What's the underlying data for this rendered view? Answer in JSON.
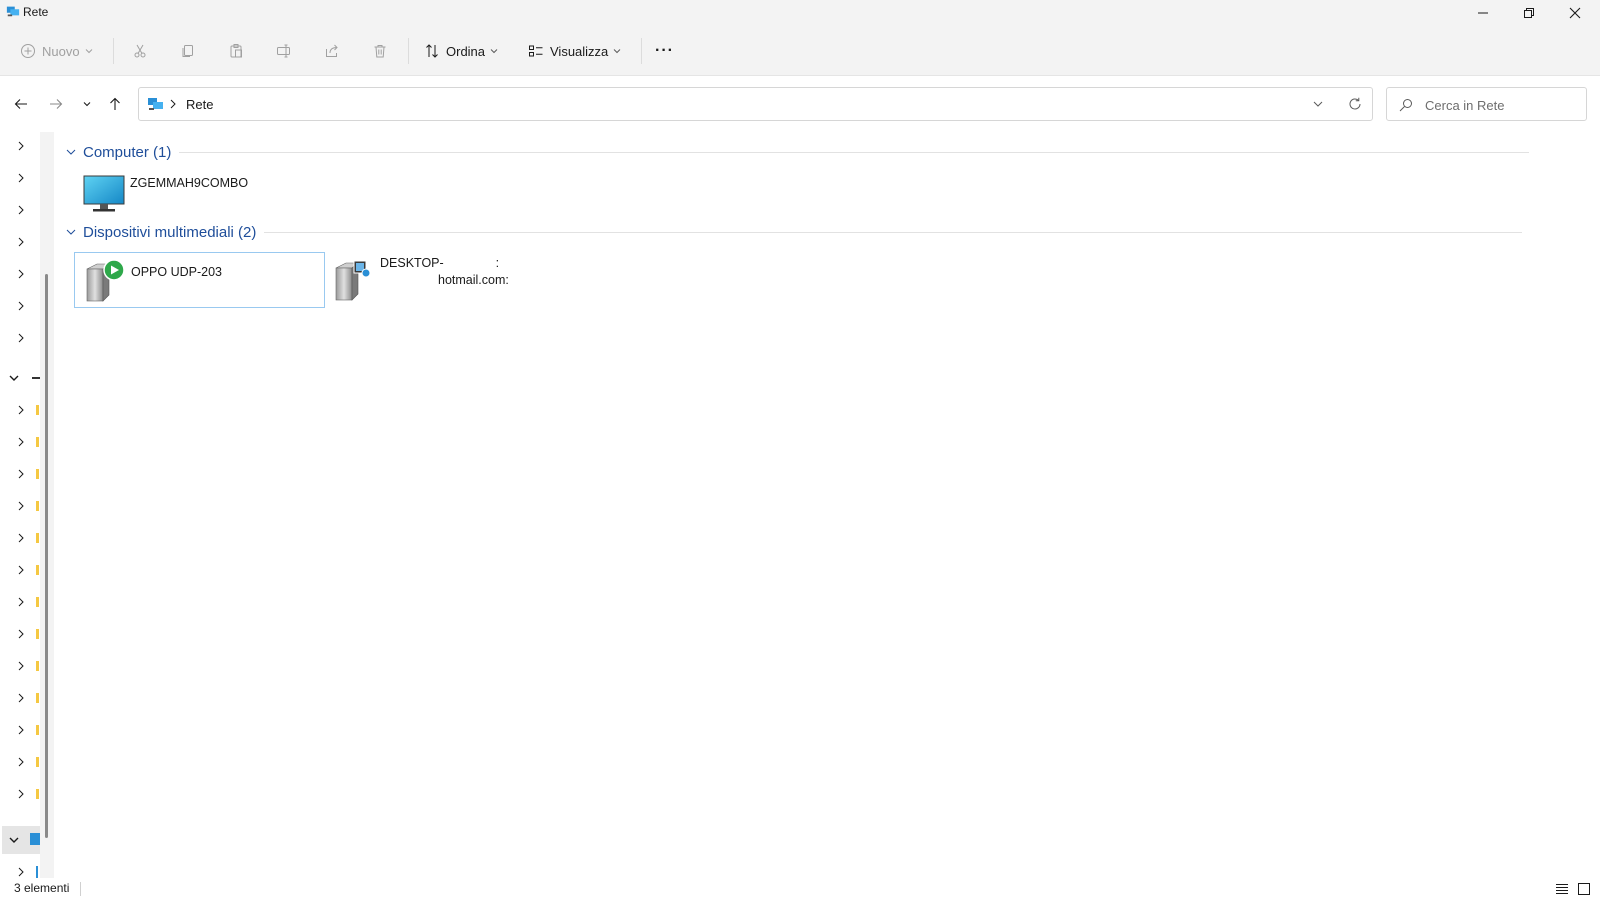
{
  "window": {
    "title": "Rete",
    "icon": "network-icon",
    "controls": [
      "minimize-icon",
      "restore-icon",
      "close-icon"
    ]
  },
  "commandbar": {
    "new_label": "Nuovo",
    "sort_label": "Ordina",
    "view_label": "Visualizza",
    "more_label": "···",
    "icons": [
      "plus-circle-icon",
      "cut-icon",
      "copy-icon",
      "paste-icon",
      "rename-icon",
      "share-icon",
      "delete-icon",
      "sort-icon",
      "view-icon",
      "more-icon"
    ]
  },
  "address": {
    "crumb": "Rete",
    "search_placeholder": "Cerca in Rete"
  },
  "groups": [
    {
      "label": "Computer (1)",
      "items": [
        {
          "name": "ZGEMMAH9COMBO",
          "icon": "monitor-icon"
        }
      ]
    },
    {
      "label": "Dispositivi multimediali (2)",
      "items": [
        {
          "name": "OPPO UDP-203",
          "icon": "media-server-play-icon"
        },
        {
          "name_line1": "DESKTOP-",
          "name_line1_suffix": ":",
          "name_line2": "hotmail.com:",
          "icon": "media-server-library-icon"
        }
      ]
    }
  ],
  "status": {
    "count": "3 elementi"
  },
  "colors": {
    "accent": "#1f4e9a",
    "selection_border": "#99c9f0",
    "chrome_bg": "#f3f3f3"
  }
}
